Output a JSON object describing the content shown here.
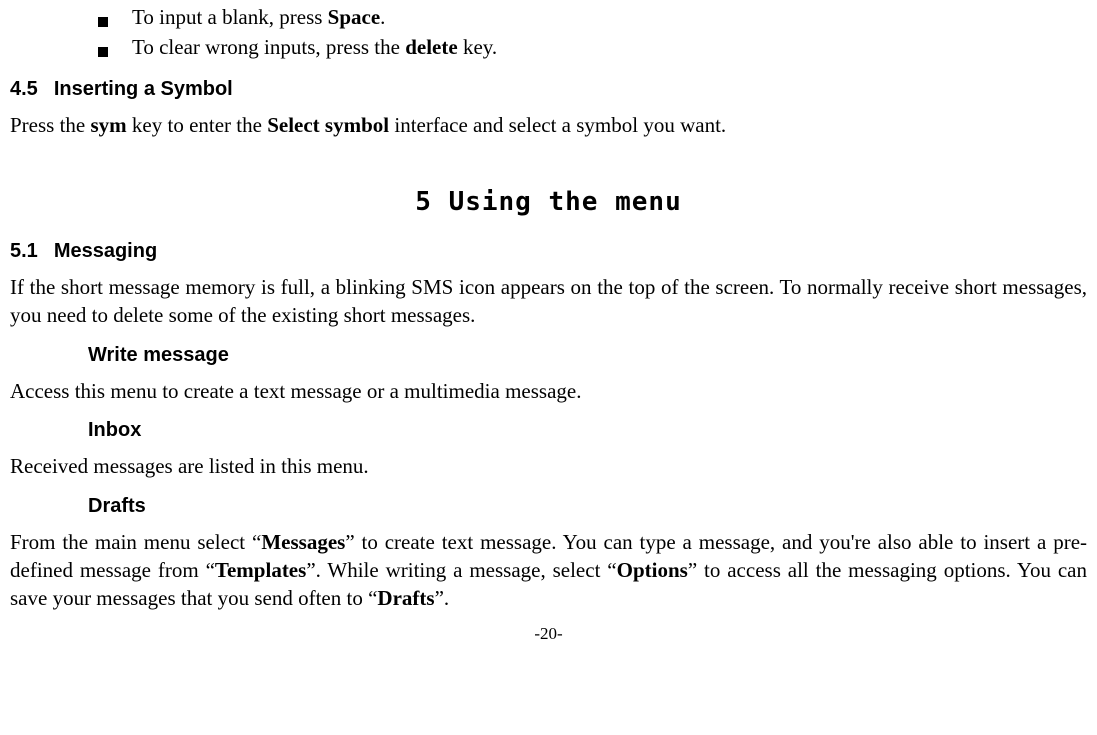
{
  "bullets": {
    "b1_pre": "To input a blank, press ",
    "b1_bold": "Space",
    "b1_post": ".",
    "b2_pre": "To clear wrong inputs, press the ",
    "b2_bold": "delete",
    "b2_post": " key."
  },
  "sec45_num": "4.5",
  "sec45_title": "Inserting a Symbol",
  "sec45_para_1": "Press the ",
  "sec45_para_b1": "sym",
  "sec45_para_2": " key to enter the ",
  "sec45_para_b2": "Select symbol",
  "sec45_para_3": " interface and select a symbol you want.",
  "chapter5": "5  Using the menu",
  "sec51_num": "5.1",
  "sec51_title": "Messaging",
  "sec51_para": "If the short message memory is full, a blinking SMS icon appears on the top of the screen. To normally receive short messages, you need to delete some of the existing short messages.",
  "sub_write": "Write message",
  "write_para": "Access this menu to create a text message or a multimedia message.",
  "sub_inbox": "Inbox",
  "inbox_para": "Received messages are listed in this menu.",
  "sub_drafts": "Drafts",
  "drafts_para_1": "From the main menu select “",
  "drafts_b1": "Messages",
  "drafts_para_2": "” to create text message. You can type a message, and you're also able to insert a pre-defined message from “",
  "drafts_b2": "Templates",
  "drafts_para_3": "”. While writing a message, select “",
  "drafts_b3": "Options",
  "drafts_para_4": "” to access all the messaging options. You can save your messages that you send often to “",
  "drafts_b4": "Drafts",
  "drafts_para_5": "”.",
  "page_number": "-20-"
}
